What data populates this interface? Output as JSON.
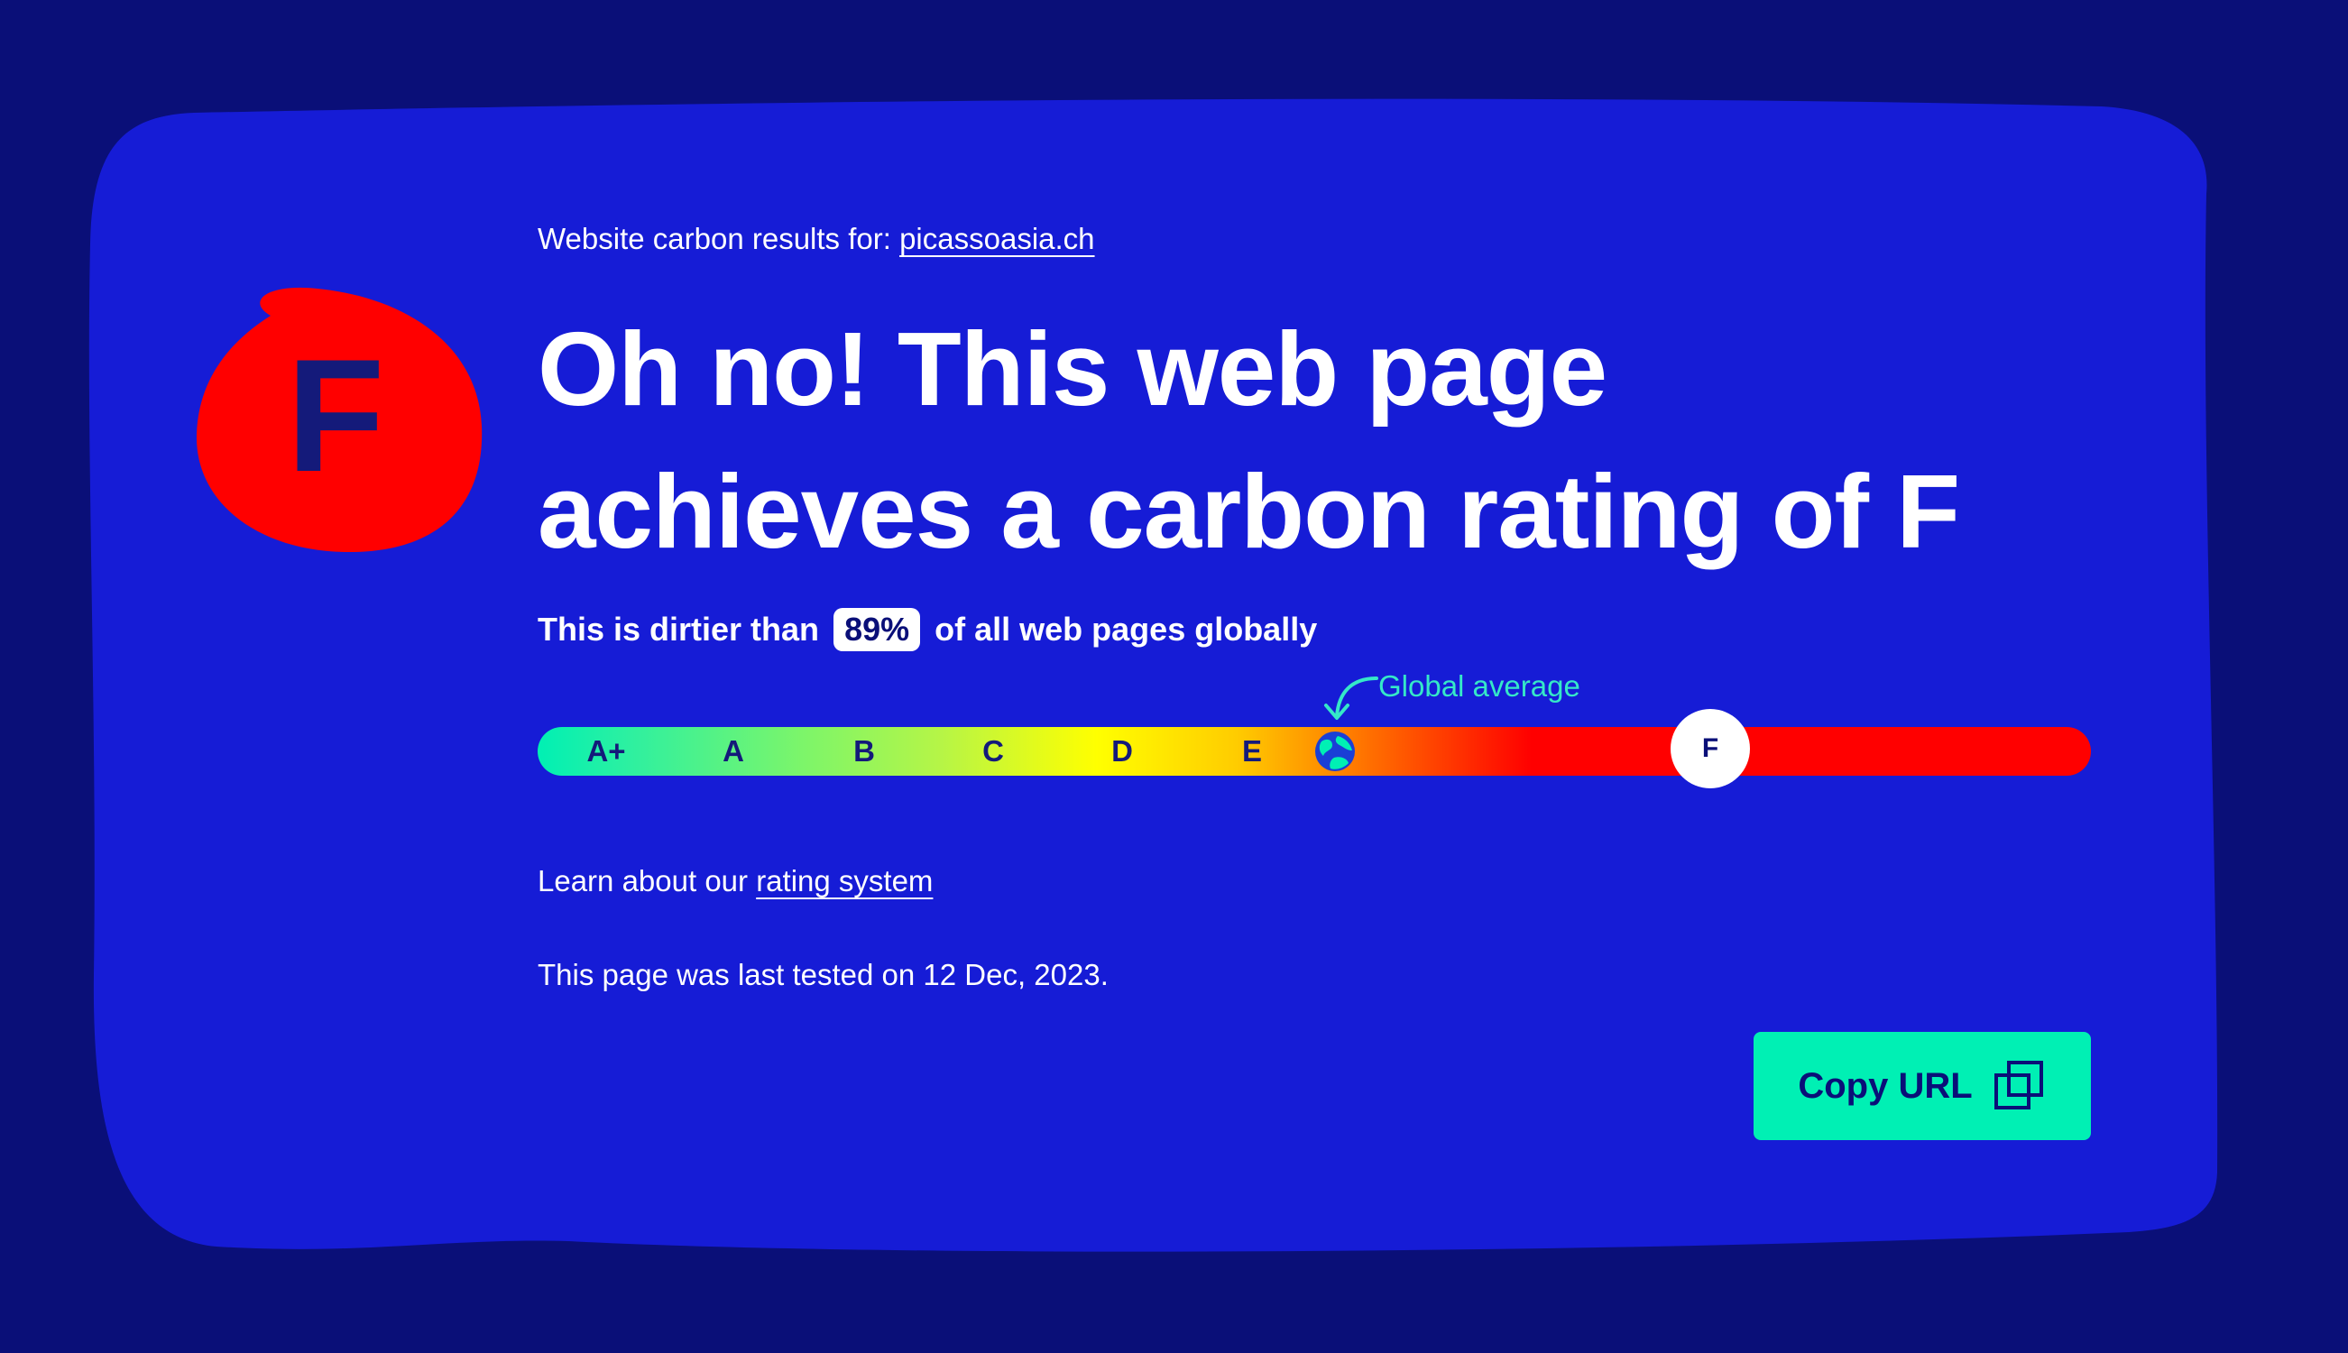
{
  "results": {
    "prefix": "Website carbon results for:",
    "site": "picassoasia.ch"
  },
  "rating": {
    "grade": "F",
    "headline_line1": "Oh no! This web page",
    "headline_line2": "achieves a carbon rating of F",
    "grade_color": "#ff0000"
  },
  "comparison": {
    "prefix": "This is dirtier than",
    "percent": "89%",
    "suffix": "of all web pages globally"
  },
  "scale": {
    "grades": [
      "A+",
      "A",
      "B",
      "C",
      "D",
      "E"
    ],
    "marker_grade": "F",
    "global_average_label": "Global average"
  },
  "learn": {
    "prefix": "Learn about our",
    "link": "rating system"
  },
  "tested": {
    "text": "This page was last tested on 12 Dec, 2023."
  },
  "actions": {
    "copy_label": "Copy URL"
  },
  "colors": {
    "page_bg": "#0a0f78",
    "card_bg": "#161cd6",
    "accent": "#00f0b4",
    "rating_red": "#ff0000"
  }
}
